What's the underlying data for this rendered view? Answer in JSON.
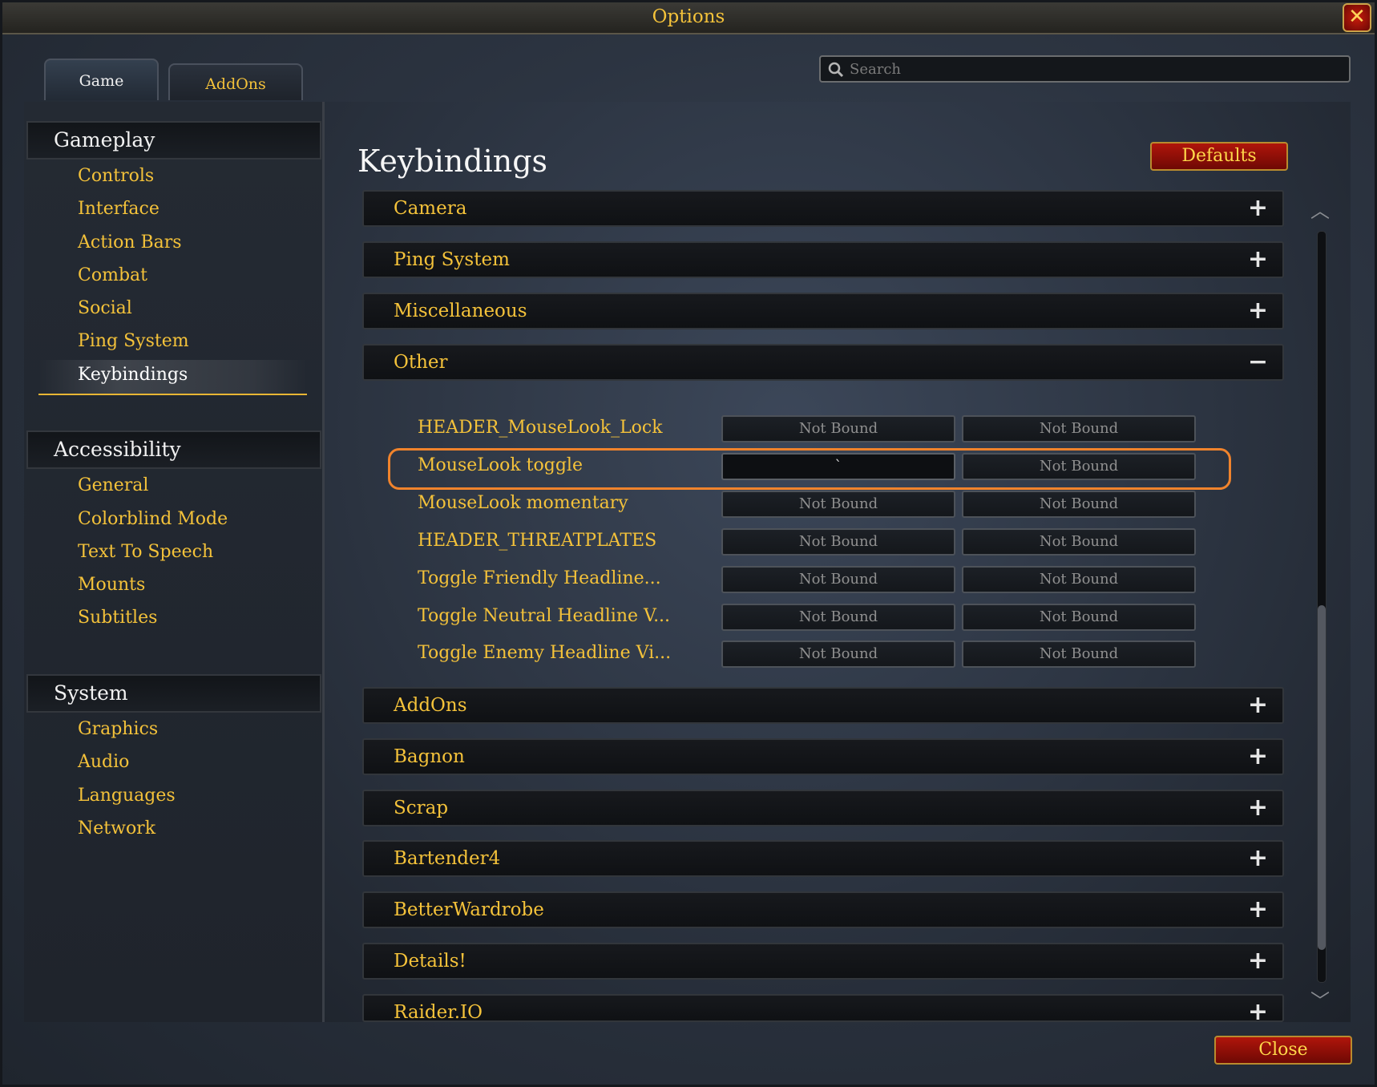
{
  "window": {
    "title": "Options"
  },
  "tabs": [
    {
      "label": "Game"
    },
    {
      "label": "AddOns"
    }
  ],
  "search": {
    "placeholder": "Search"
  },
  "sidebar": {
    "categories": [
      {
        "title": "Gameplay",
        "items": [
          "Controls",
          "Interface",
          "Action Bars",
          "Combat",
          "Social",
          "Ping System",
          "Keybindings"
        ]
      },
      {
        "title": "Accessibility",
        "items": [
          "General",
          "Colorblind Mode",
          "Text To Speech",
          "Mounts",
          "Subtitles"
        ]
      },
      {
        "title": "System",
        "items": [
          "Graphics",
          "Audio",
          "Languages",
          "Network"
        ]
      }
    ],
    "selected": "Keybindings"
  },
  "main": {
    "title": "Keybindings",
    "defaults_label": "Defaults",
    "sections_top": [
      {
        "label": "Camera",
        "icon": "+"
      },
      {
        "label": "Ping System",
        "icon": "+"
      },
      {
        "label": "Miscellaneous",
        "icon": "+"
      },
      {
        "label": "Other",
        "icon": "−"
      }
    ],
    "bindings": [
      {
        "label": "HEADER_MouseLook_Lock",
        "key1": "Not Bound",
        "key2": "Not Bound"
      },
      {
        "label": "MouseLook toggle",
        "key1": "`",
        "key2": "Not Bound"
      },
      {
        "label": "MouseLook momentary",
        "key1": "Not Bound",
        "key2": "Not Bound"
      },
      {
        "label": "HEADER_THREATPLATES",
        "key1": "Not Bound",
        "key2": "Not Bound"
      },
      {
        "label": "Toggle Friendly Headline...",
        "key1": "Not Bound",
        "key2": "Not Bound"
      },
      {
        "label": "Toggle Neutral Headline V...",
        "key1": "Not Bound",
        "key2": "Not Bound"
      },
      {
        "label": "Toggle Enemy Headline Vi...",
        "key1": "Not Bound",
        "key2": "Not Bound"
      }
    ],
    "sections_bottom": [
      {
        "label": "AddOns",
        "icon": "+"
      },
      {
        "label": "Bagnon",
        "icon": "+"
      },
      {
        "label": "Scrap",
        "icon": "+"
      },
      {
        "label": "Bartender4",
        "icon": "+"
      },
      {
        "label": "BetterWardrobe",
        "icon": "+"
      },
      {
        "label": "Details!",
        "icon": "+"
      },
      {
        "label": "Raider.IO",
        "icon": "+"
      }
    ]
  },
  "footer": {
    "close_label": "Close"
  },
  "colors": {
    "accent_gold": "#f4c23a",
    "button_red": "#b0150b",
    "highlight_orange": "#f0832c"
  },
  "icons": {
    "search": "search-icon",
    "close": "close-icon",
    "expand": "plus-icon",
    "collapse": "minus-icon"
  }
}
